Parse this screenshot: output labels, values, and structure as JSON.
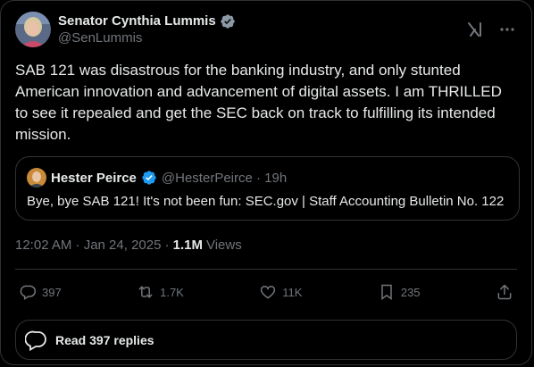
{
  "author": {
    "display_name": "Senator Cynthia Lummis",
    "handle": "@SenLummis",
    "verified": true,
    "verified_color": "#8b98a5"
  },
  "tweet": {
    "text": "SAB 121 was disastrous for the banking industry, and only stunted\nAmerican innovation and advancement of digital assets. I am THRILLED\nto see it repealed and get the SEC back on track to fulfilling its intended\nmission."
  },
  "quote": {
    "display_name": "Hester Peirce",
    "verified": true,
    "verified_color": "#1d9bf0",
    "handle_time": "@HesterPeirce · 19h",
    "text": "Bye, bye SAB 121! It's not been fun: SEC.gov | Staff Accounting Bulletin No. 122"
  },
  "meta": {
    "timestamp": "12:02 AM · Jan 24, 2025 · ",
    "views_count": "1.1M",
    "views_label": "Views"
  },
  "actions": {
    "replies": "397",
    "reposts": "1.7K",
    "likes": "11K",
    "bookmarks": "235"
  },
  "read_replies": {
    "label": "Read 397 replies"
  },
  "icons": [
    "verified-badge-icon",
    "grok-icon",
    "more-icon",
    "reply-icon",
    "repost-icon",
    "like-icon",
    "bookmark-icon",
    "share-icon",
    "replies-bubble-icon"
  ],
  "colors": {
    "background": "#000000",
    "text": "#e7e9ea",
    "secondary": "#71767b",
    "border": "#2f3336",
    "accent": "#1d9bf0"
  }
}
